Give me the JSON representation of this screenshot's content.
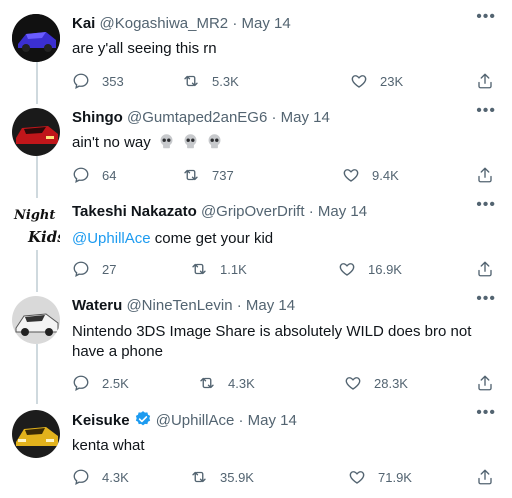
{
  "tweets": [
    {
      "name": "Kai",
      "handle": "@Kogashiwa_MR2",
      "date": "May 14",
      "text": "are y'all seeing this rn",
      "replies": "353",
      "retweets": "5.3K",
      "likes": "23K",
      "avatar_color": "#3b2fd0"
    },
    {
      "name": "Shingo",
      "handle": "@Gumtaped2anEG6",
      "date": "May 14",
      "text": "ain't no way",
      "replies": "64",
      "retweets": "737",
      "likes": "9.4K",
      "avatar_color": "#c0161a"
    },
    {
      "name": "Takeshi Nakazato",
      "handle": "@GripOverDrift",
      "date": "May 14",
      "mention": "@UphillAce",
      "text": "come get your kid",
      "avatar_text": "Night Kids",
      "replies": "27",
      "retweets": "1.1K",
      "likes": "16.9K",
      "avatar_color": "#ffffff"
    },
    {
      "name": "Wateru",
      "handle": "@NineTenLevin",
      "date": "May 14",
      "text": "Nintendo 3DS Image Share is absolutely WILD does bro not have a phone",
      "replies": "2.5K",
      "retweets": "4.3K",
      "likes": "28.3K",
      "avatar_color": "#8a8a8a"
    },
    {
      "name": "Keisuke",
      "handle": "@UphillAce",
      "date": "May 14",
      "text": "kenta what",
      "replies": "4.3K",
      "retweets": "35.9K",
      "likes": "71.9K",
      "avatar_color": "#e2b21c",
      "verified": true
    }
  ],
  "colors": {
    "accent": "#1d9bf0",
    "muted": "#536471",
    "thread_line": "#cfd9de"
  },
  "icons": [
    "reply-icon",
    "retweet-icon",
    "like-icon",
    "share-icon",
    "more-icon",
    "verified-icon",
    "skull-emoji"
  ]
}
